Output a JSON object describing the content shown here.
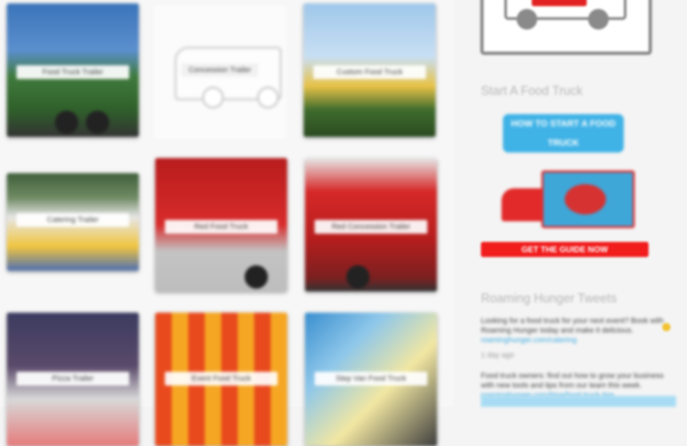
{
  "gallery": {
    "items": [
      {
        "label": "Food Truck Trailer"
      },
      {
        "label": "Concession Trailer"
      },
      {
        "label": "Custom Food Truck"
      },
      {
        "label": "Catering Trailer"
      },
      {
        "label": "Red Food Truck"
      },
      {
        "label": "Red Concession Trailer"
      },
      {
        "label": "Pizza Trailer"
      },
      {
        "label": "Event Food Truck"
      },
      {
        "label": "Step Van Food Truck"
      }
    ]
  },
  "sidebar": {
    "logo_text": "FOOD TRUCK",
    "start_title": "Start A Food Truck",
    "promo_text": "HOW TO START A FOOD TRUCK",
    "promo_button": "GET THE GUIDE NOW",
    "twitter_title": "Roaming Hunger Tweets",
    "tweets": [
      {
        "text": "Looking for a food truck for your next event? Book with Roaming Hunger today and make it delicious.",
        "link": "roaminghunger.com/catering",
        "time": "1 day ago"
      },
      {
        "text": "Food truck owners: find out how to grow your business with new tools and tips from our team this week.",
        "link": "roaminghunger.com/blog/food-truck-tips",
        "time": ""
      }
    ]
  },
  "colors": {
    "accent_red": "#f11c1c",
    "accent_blue": "#3fb2e6",
    "link": "#3aa9e0"
  }
}
